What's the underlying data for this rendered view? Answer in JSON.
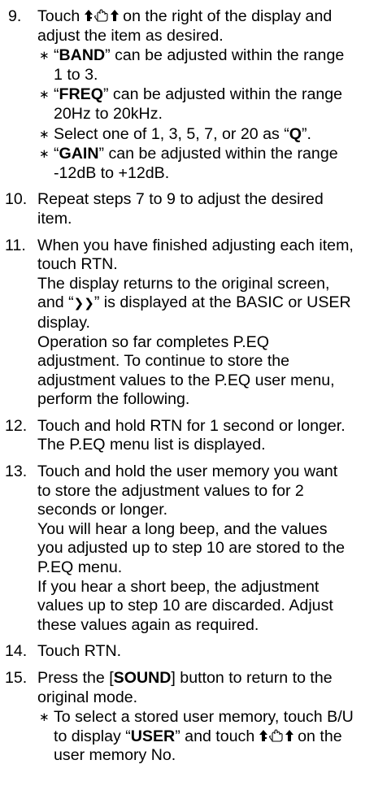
{
  "steps": [
    {
      "num": "9.",
      "l1a": "Touch ",
      "l1b": " on the right of the display and",
      "l2": "adjust the item as desired.",
      "bullets": [
        {
          "q1": "“",
          "b": "BAND",
          "q2": "” can be adjusted within the range",
          "l2": "1 to 3."
        },
        {
          "q1": "“",
          "b": "FREQ",
          "q2": "” can be adjusted within the range",
          "l2": "20Hz to 20kHz."
        },
        {
          "pre": "Select one of 1, 3, 5, 7, or 20 as “",
          "b": "Q",
          "post": "”."
        },
        {
          "q1": "“",
          "b": "GAIN",
          "q2": "” can be adjusted within the range",
          "l2": "-12dB to +12dB."
        }
      ]
    },
    {
      "num": "10.",
      "lines": [
        "Repeat steps 7 to 9 to adjust the desired",
        "item."
      ]
    },
    {
      "num": "11.",
      "l1": "When you have finished adjusting each item,",
      "l2": "touch RTN.",
      "l3": "The display returns to the original screen,",
      "l4a": "and “",
      "l4b": "❯❯",
      "l4c": "” is displayed at the BASIC or USER",
      "l5": "display.",
      "l6": "Operation so far completes P.EQ",
      "l7": "adjustment. To continue to store the",
      "l8": "adjustment values to the P.EQ user menu,",
      "l9": "perform the following."
    },
    {
      "num": "12.",
      "lines": [
        "Touch and hold RTN for 1 second or longer.",
        "The P.EQ menu list is displayed."
      ]
    },
    {
      "num": "13.",
      "lines": [
        "Touch and hold the user memory you want",
        "to store the adjustment values to for 2",
        "seconds or longer.",
        "You will hear a long beep, and the values",
        "you adjusted up to step 10 are stored to the",
        "P.EQ menu.",
        "If you hear a short beep, the adjustment",
        "values up to step 10 are discarded. Adjust",
        "these values again as required."
      ]
    },
    {
      "num": "14.",
      "lines": [
        "Touch RTN."
      ]
    },
    {
      "num": "15.",
      "l1a": "Press the [",
      "l1b": "SOUND",
      "l1c": "] button to return to the",
      "l2": "original mode.",
      "bullet": {
        "l1": "To select a stored user memory, touch B/U",
        "l2a": "to display “",
        "l2b": "USER",
        "l2c": "” and touch ",
        "l2d": " on the",
        "l3": "user memory No."
      }
    }
  ],
  "bullet_char": "∗",
  "icon": "touch-hold-arrows-icon"
}
